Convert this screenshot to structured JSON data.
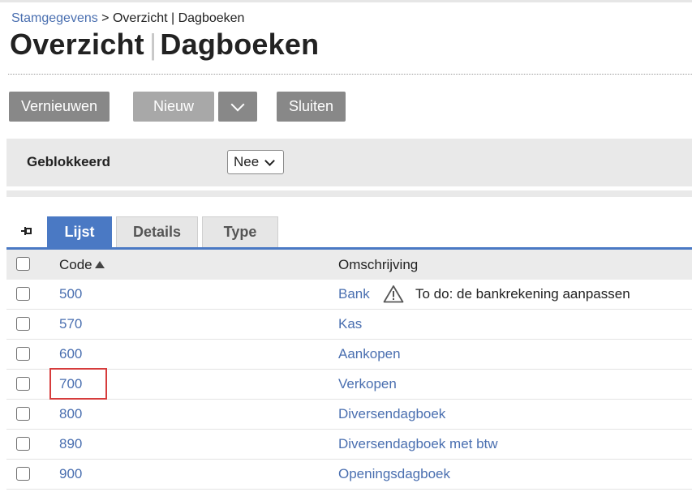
{
  "breadcrumb": {
    "link": "Stamgegevens",
    "rest": " > Overzicht | Dagboeken"
  },
  "title": {
    "part1": "Overzicht",
    "separator": "|",
    "part2": "Dagboeken"
  },
  "toolbar": {
    "refresh_label": "Vernieuwen",
    "new_label": "Nieuw",
    "new_dropdown_icon": "chevron-down-icon",
    "close_label": "Sluiten"
  },
  "filter": {
    "label": "Geblokkeerd",
    "value": "Nee"
  },
  "tabs": [
    {
      "label": "Lijst",
      "active": true
    },
    {
      "label": "Details",
      "active": false
    },
    {
      "label": "Type",
      "active": false
    }
  ],
  "table": {
    "headers": {
      "code": "Code",
      "description": "Omschrijving"
    },
    "sort": {
      "column": "code",
      "direction": "ascending"
    },
    "rows": [
      {
        "code": "500",
        "description": "Bank",
        "note_icon": "warning-icon",
        "note": "To do: de bankrekening aanpassen"
      },
      {
        "code": "570",
        "description": "Kas"
      },
      {
        "code": "600",
        "description": "Aankopen"
      },
      {
        "code": "700",
        "description": "Verkopen",
        "highlighted": true
      },
      {
        "code": "800",
        "description": "Diversendagboek"
      },
      {
        "code": "890",
        "description": "Diversendagboek met btw"
      },
      {
        "code": "900",
        "description": "Openingsdagboek"
      }
    ]
  },
  "colors": {
    "accent": "#4a79c4",
    "link": "#4a6fb0",
    "button": "#888888",
    "highlight": "#d63c3c"
  }
}
